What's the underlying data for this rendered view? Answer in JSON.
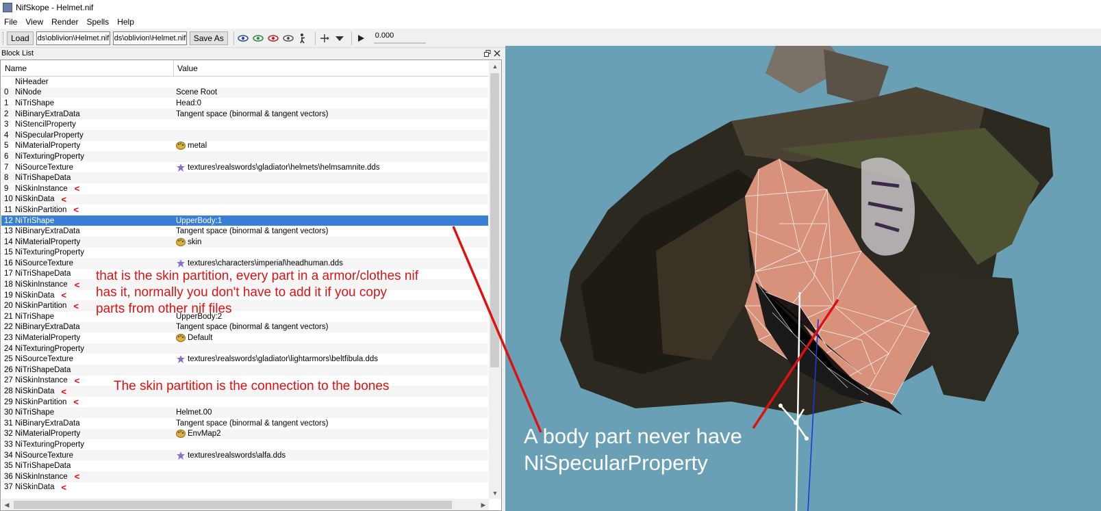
{
  "window": {
    "title": "NifSkope - Helmet.nif"
  },
  "menu": [
    "File",
    "View",
    "Render",
    "Spells",
    "Help"
  ],
  "toolbar": {
    "load_label": "Load",
    "load_path": "ds\\oblivion\\Helmet.nif",
    "save_path": "ds\\oblivion\\Helmet.nif",
    "save_as_label": "Save As",
    "time_value": "0.000"
  },
  "dock": {
    "title": "Block List"
  },
  "table": {
    "columns": [
      "Name",
      "Value"
    ],
    "rows": [
      {
        "idx": "",
        "name": "NiHeader",
        "value": "",
        "icon": "",
        "mark": ""
      },
      {
        "idx": "0",
        "name": "NiNode",
        "value": "Scene Root",
        "icon": "",
        "mark": ""
      },
      {
        "idx": "1",
        "name": "NiTriShape",
        "value": "Head:0",
        "icon": "",
        "mark": ""
      },
      {
        "idx": "2",
        "name": "NiBinaryExtraData",
        "value": "Tangent space (binormal & tangent vectors)",
        "icon": "",
        "mark": ""
      },
      {
        "idx": "3",
        "name": "NiStencilProperty",
        "value": "",
        "icon": "",
        "mark": ""
      },
      {
        "idx": "4",
        "name": "NiSpecularProperty",
        "value": "",
        "icon": "",
        "mark": ""
      },
      {
        "idx": "5",
        "name": "NiMaterialProperty",
        "value": "metal",
        "icon": "palette-icon",
        "mark": ""
      },
      {
        "idx": "6",
        "name": "NiTexturingProperty",
        "value": "",
        "icon": "",
        "mark": ""
      },
      {
        "idx": "7",
        "name": "NiSourceTexture",
        "value": "textures\\realswords\\gladiator\\helmets\\helmsamnite.dds",
        "icon": "texture-icon",
        "mark": ""
      },
      {
        "idx": "8",
        "name": "NiTriShapeData",
        "value": "",
        "icon": "",
        "mark": ""
      },
      {
        "idx": "9",
        "name": "NiSkinInstance",
        "value": "",
        "icon": "",
        "mark": "<"
      },
      {
        "idx": "10",
        "name": "NiSkinData",
        "value": "",
        "icon": "",
        "mark": "<"
      },
      {
        "idx": "11",
        "name": "NiSkinPartition",
        "value": "",
        "icon": "",
        "mark": "<"
      },
      {
        "idx": "12",
        "name": "NiTriShape",
        "value": "UpperBody:1",
        "icon": "",
        "mark": "",
        "selected": true
      },
      {
        "idx": "13",
        "name": "NiBinaryExtraData",
        "value": "Tangent space (binormal & tangent vectors)",
        "icon": "",
        "mark": ""
      },
      {
        "idx": "14",
        "name": "NiMaterialProperty",
        "value": "skin",
        "icon": "palette-icon",
        "mark": ""
      },
      {
        "idx": "15",
        "name": "NiTexturingProperty",
        "value": "",
        "icon": "",
        "mark": ""
      },
      {
        "idx": "16",
        "name": "NiSourceTexture",
        "value": "textures\\characters\\imperial\\headhuman.dds",
        "icon": "texture-icon",
        "mark": ""
      },
      {
        "idx": "17",
        "name": "NiTriShapeData",
        "value": "",
        "icon": "",
        "mark": ""
      },
      {
        "idx": "18",
        "name": "NiSkinInstance",
        "value": "",
        "icon": "",
        "mark": "<"
      },
      {
        "idx": "19",
        "name": "NiSkinData",
        "value": "",
        "icon": "",
        "mark": "<"
      },
      {
        "idx": "20",
        "name": "NiSkinPartition",
        "value": "",
        "icon": "",
        "mark": "<"
      },
      {
        "idx": "21",
        "name": "NiTriShape",
        "value": "UpperBody:2",
        "icon": "",
        "mark": ""
      },
      {
        "idx": "22",
        "name": "NiBinaryExtraData",
        "value": "Tangent space (binormal & tangent vectors)",
        "icon": "",
        "mark": ""
      },
      {
        "idx": "23",
        "name": "NiMaterialProperty",
        "value": "Default",
        "icon": "palette-icon",
        "mark": ""
      },
      {
        "idx": "24",
        "name": "NiTexturingProperty",
        "value": "",
        "icon": "",
        "mark": ""
      },
      {
        "idx": "25",
        "name": "NiSourceTexture",
        "value": "textures\\realswords\\gladiator\\lightarmors\\beltfibula.dds",
        "icon": "texture-icon",
        "mark": ""
      },
      {
        "idx": "26",
        "name": "NiTriShapeData",
        "value": "",
        "icon": "",
        "mark": ""
      },
      {
        "idx": "27",
        "name": "NiSkinInstance",
        "value": "",
        "icon": "",
        "mark": "<"
      },
      {
        "idx": "28",
        "name": "NiSkinData",
        "value": "",
        "icon": "",
        "mark": "<"
      },
      {
        "idx": "29",
        "name": "NiSkinPartition",
        "value": "",
        "icon": "",
        "mark": "<"
      },
      {
        "idx": "30",
        "name": "NiTriShape",
        "value": "Helmet.00",
        "icon": "",
        "mark": ""
      },
      {
        "idx": "31",
        "name": "NiBinaryExtraData",
        "value": "Tangent space (binormal & tangent vectors)",
        "icon": "",
        "mark": ""
      },
      {
        "idx": "32",
        "name": "NiMaterialProperty",
        "value": "EnvMap2",
        "icon": "palette-icon",
        "mark": ""
      },
      {
        "idx": "33",
        "name": "NiTexturingProperty",
        "value": "",
        "icon": "",
        "mark": ""
      },
      {
        "idx": "34",
        "name": "NiSourceTexture",
        "value": "textures\\realswords\\alfa.dds",
        "icon": "texture-icon",
        "mark": ""
      },
      {
        "idx": "35",
        "name": "NiTriShapeData",
        "value": "",
        "icon": "",
        "mark": ""
      },
      {
        "idx": "36",
        "name": "NiSkinInstance",
        "value": "",
        "icon": "",
        "mark": "<"
      },
      {
        "idx": "37",
        "name": "NiSkinData",
        "value": "",
        "icon": "",
        "mark": "<"
      }
    ]
  },
  "annotations": {
    "partition_line1": "that is the skin partition, every part in a armor/clothes nif",
    "partition_line2": "has it, normally you don't have to add it if you copy",
    "partition_line3": "parts from other nif files",
    "bones_note": "The skin partition is the connection to the bones",
    "body_line1": "A body part never have",
    "body_line2": "NiSpecularProperty"
  },
  "colors": {
    "selection": "#3b7fd4",
    "annotation_red": "#e01010",
    "viewport_bg": "#6aa0b5"
  }
}
